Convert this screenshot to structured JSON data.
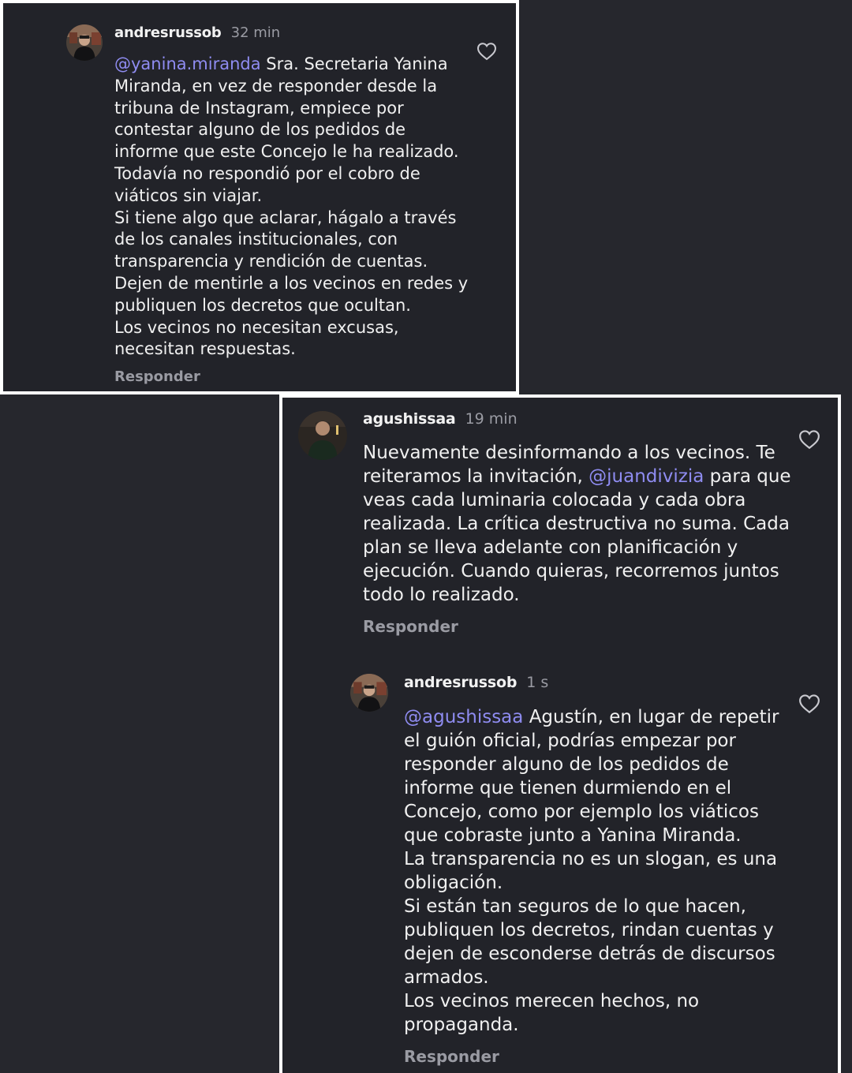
{
  "comments": [
    {
      "username": "andresrussob",
      "time": "32 min",
      "mention": "@yanina.miranda",
      "lines": [
        " Sra. Secretaria Yanina",
        "Miranda, en vez de responder desde la",
        "tribuna de Instagram, empiece por",
        "contestar alguno de los pedidos de",
        "informe que este Concejo le ha realizado.",
        "Todavía no respondió por el cobro de",
        "viáticos sin viajar.",
        "Si tiene algo que aclarar, hágalo a través",
        "de los canales institucionales, con",
        "transparencia y rendición de cuentas.",
        "Dejen de mentirle a los vecinos en redes y",
        "publiquen los decretos que ocultan.",
        "Los vecinos no necesitan excusas,",
        "necesitan respuestas."
      ],
      "reply_label": "Responder",
      "avatar_icon": "profile-photo-icon",
      "like_icon": "heart-outline-icon"
    },
    {
      "username": "agushissaa",
      "time": "19 min",
      "line1": "Nuevamente desinformando a los vecinos. Te",
      "line2_before": "reiteramos la invitación, ",
      "line2_mention": "@juandivizia",
      "line2_after": " para que",
      "lines_rest": [
        "veas cada luminaria colocada y cada obra",
        "realizada. La crítica destructiva no suma. Cada",
        "plan se lleva adelante con planificación y",
        "ejecución. Cuando quieras, recorremos juntos",
        "todo lo realizado."
      ],
      "reply_label": "Responder",
      "avatar_icon": "profile-photo-icon",
      "like_icon": "heart-outline-icon"
    },
    {
      "username": "andresrussob",
      "time": "1 s",
      "mention": "@agushissaa",
      "lines": [
        " Agustín, en lugar de repetir",
        "el guión oficial, podrías empezar por",
        "responder alguno de los pedidos de",
        "informe que tienen durmiendo en el",
        "Concejo, como por ejemplo los viáticos",
        "que cobraste junto a Yanina Miranda.",
        "La transparencia no es un slogan, es una",
        "obligación.",
        "Si están tan seguros de lo que hacen,",
        "publiquen los decretos, rindan cuentas y",
        "dejen de esconderse detrás de discursos",
        "armados.",
        "Los vecinos merecen hechos, no",
        "propaganda."
      ],
      "reply_label": "Responder",
      "avatar_icon": "profile-photo-icon",
      "like_icon": "heart-outline-icon"
    }
  ],
  "colors": {
    "background": "#222329",
    "text": "#f0f0f0",
    "muted": "#9a9ba3",
    "mention": "#8f8cf1",
    "border": "#ffffff"
  }
}
